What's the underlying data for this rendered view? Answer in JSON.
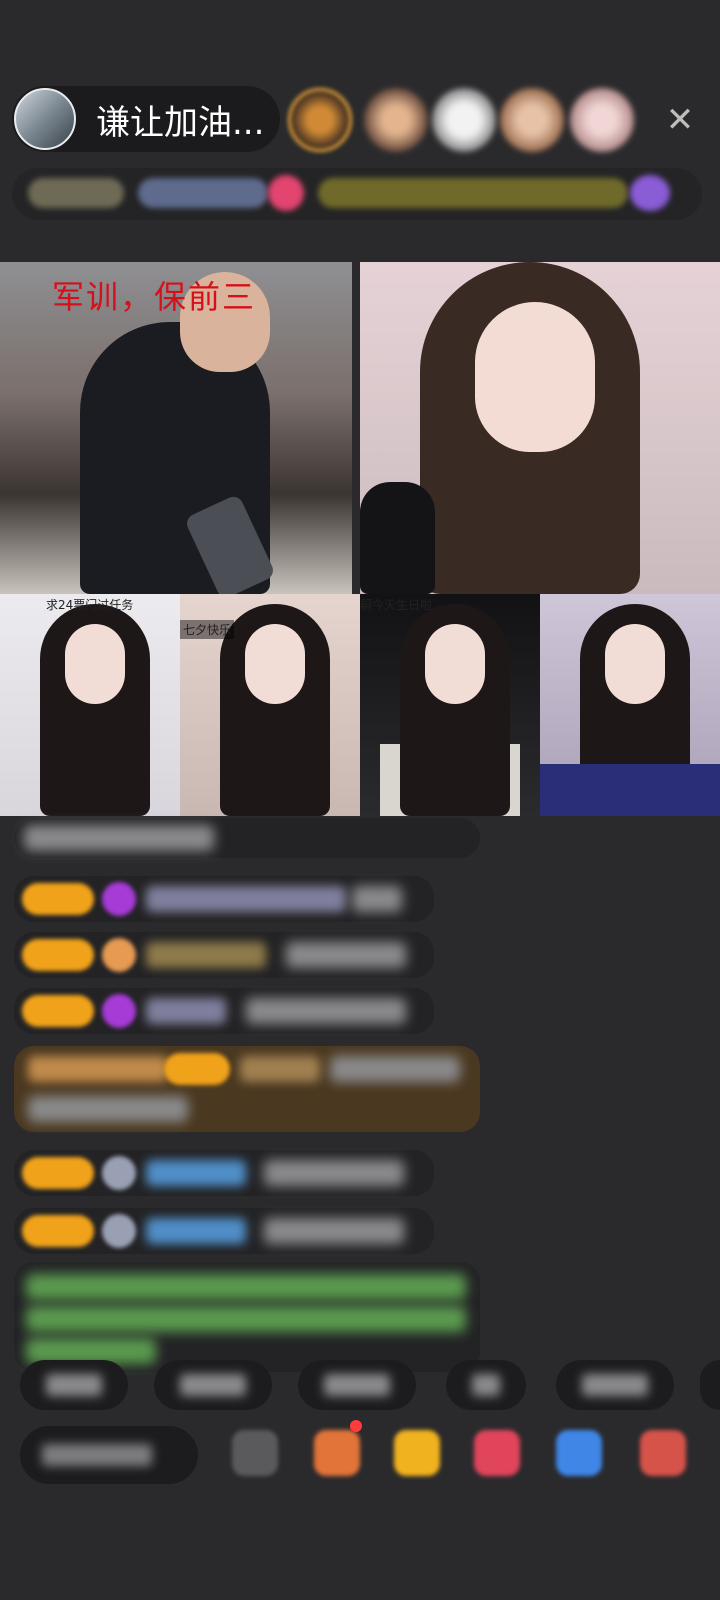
{
  "header": {
    "host_name": "谦让加油...",
    "close_label": "✕"
  },
  "stream": {
    "tile1_title": "军训，保前三",
    "tile3_caption": "求24票门过任务",
    "tile4_caption": "七夕快乐",
    "tile5_caption": "嗣今天生日啦"
  },
  "colors": {
    "background": "#2a2a2c",
    "badge": "#f0a21a",
    "title_red": "#d6101a"
  },
  "icons": {
    "close": "close-icon",
    "gift": "gift-icon",
    "emoji": "emoji-icon"
  }
}
